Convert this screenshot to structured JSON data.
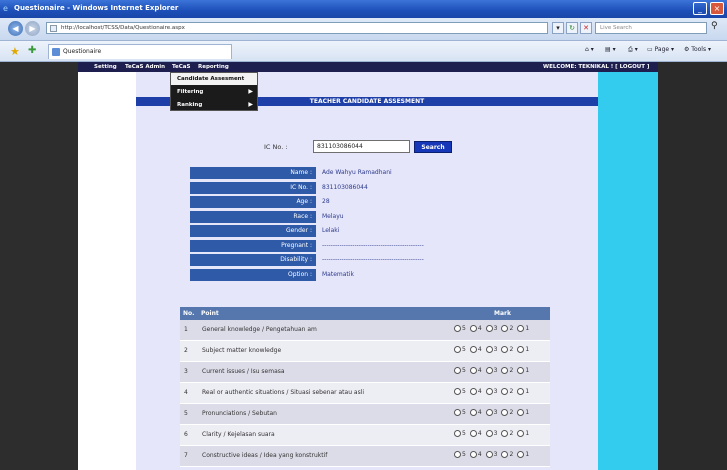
{
  "browser": {
    "window_title": "Questionaire - Windows Internet Explorer",
    "url": "http://localhost/TCSS/Data/Questionaire.aspx",
    "search_placeholder": "Live Search",
    "tab_title": "Questionaire",
    "tools": {
      "page": "Page",
      "tools": "Tools"
    }
  },
  "nav": {
    "items": [
      "Setting",
      "TeCaS Admin",
      "TeCaS",
      "Reporting"
    ],
    "welcome": "WELCOME: TEKNIKAL ! [ LOGOUT ]"
  },
  "menu": {
    "items": [
      "Candidate Assesment",
      "Filtering",
      "Ranking"
    ]
  },
  "page_title": "TEACHER CANDIDATE ASSESMENT",
  "search": {
    "label": "IC No. :",
    "value": "831103086044",
    "button": "Search"
  },
  "info": [
    {
      "label": "Name :",
      "value": "Ade Wahyu Ramadhani"
    },
    {
      "label": "IC No. :",
      "value": "831103086044"
    },
    {
      "label": "Age :",
      "value": "28"
    },
    {
      "label": "Race :",
      "value": "Melayu"
    },
    {
      "label": "Gender :",
      "value": "Lelaki"
    },
    {
      "label": "Pregnant :",
      "value": "-----------------------------------------------"
    },
    {
      "label": "Disability :",
      "value": "-----------------------------------------------"
    },
    {
      "label": "Option :",
      "value": "Matematik"
    }
  ],
  "table": {
    "headers": {
      "no": "No.",
      "point": "Point",
      "mark": "Mark"
    },
    "marks": [
      "5",
      "4",
      "3",
      "2",
      "1"
    ],
    "rows": [
      {
        "no": "1",
        "point": "General knowledge / Pengetahuan am"
      },
      {
        "no": "2",
        "point": "Subject matter knowledge"
      },
      {
        "no": "3",
        "point": "Current issues / Isu semasa"
      },
      {
        "no": "4",
        "point": "Real or authentic situations / Situasi sebenar atau asli"
      },
      {
        "no": "5",
        "point": "Pronunciations / Sebutan"
      },
      {
        "no": "6",
        "point": "Clarity / Kejelasan suara"
      },
      {
        "no": "7",
        "point": "Constructive ideas / Idea yang konstruktif"
      }
    ]
  },
  "colors": {
    "panel_bg": "#e6e6fa",
    "title_strip": "#1f3fa8",
    "label_bg": "#2f5aa8",
    "table_header": "#5577ad",
    "row_even": "#dcdce8",
    "row_odd": "#ededf4",
    "right_cyan": "#33ccee"
  }
}
